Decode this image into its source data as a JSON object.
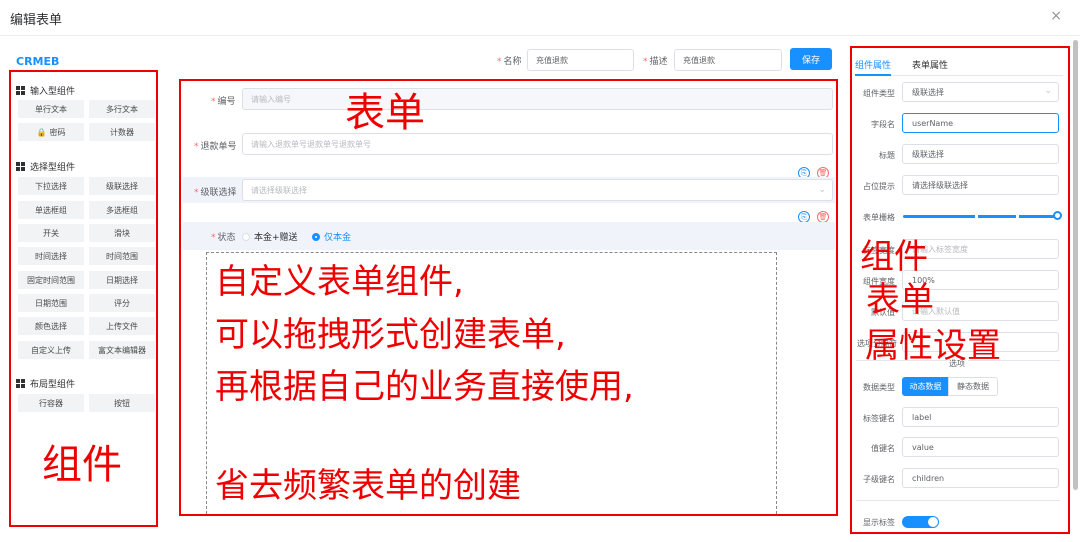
{
  "dialog": {
    "title": "编辑表单",
    "close_icon": "×"
  },
  "logo": "CRMEB",
  "palette": {
    "groups": [
      {
        "title": "输入型组件",
        "items": [
          "单行文本",
          "多行文本",
          "密码",
          "计数器"
        ]
      },
      {
        "title": "选择型组件",
        "items": [
          "下拉选择",
          "级联选择",
          "单选框组",
          "多选框组",
          "开关",
          "滑块",
          "时间选择",
          "时间范围",
          "固定时间范围",
          "日期选择",
          "日期范围",
          "评分",
          "颜色选择",
          "上传文件",
          "自定义上传",
          "富文本编辑器"
        ]
      },
      {
        "title": "布局型组件",
        "items": [
          "行容器",
          "按钮"
        ]
      }
    ],
    "annotation": "组件"
  },
  "header": {
    "name_label": "名称",
    "name_value": "充值退款",
    "desc_label": "描述",
    "desc_value": "充值退款",
    "save_label": "保存"
  },
  "form": {
    "annotation": "表单",
    "rows": {
      "number": {
        "label": "编号",
        "placeholder": "请输入编号"
      },
      "refund": {
        "label": "退款单号",
        "placeholder": "请输入退款单号退款单号退款单号"
      },
      "cascade": {
        "label": "级联选择",
        "placeholder": "请选择级联选择"
      },
      "status": {
        "label": "状态",
        "options": [
          "本金+赠送",
          "仅本金"
        ],
        "selected": "仅本金"
      }
    },
    "overlay_lines": [
      "自定义表单组件,",
      "可以拖拽形式创建表单,",
      "再根据自己的业务直接使用,",
      "省去频繁表单的创建"
    ]
  },
  "panel": {
    "tabs": [
      "组件属性",
      "表单属性"
    ],
    "active_tab": "组件属性",
    "annotation_lines": [
      "组件",
      "表单",
      "属性设置"
    ],
    "fields": {
      "type": {
        "label": "组件类型",
        "value": "级联选择"
      },
      "field": {
        "label": "字段名",
        "value": "userName"
      },
      "title": {
        "label": "标题",
        "value": "级联选择"
      },
      "placeholder": {
        "label": "占位提示",
        "value": "请选择级联选择"
      },
      "grid": {
        "label": "表单栅格"
      },
      "label_width": {
        "label": "标签宽度",
        "placeholder": "请输入标签宽度"
      },
      "comp_width": {
        "label": "组件宽度",
        "value": "100%"
      },
      "default": {
        "label": "默认值",
        "placeholder": "请输入默认值"
      },
      "sep": {
        "label": "选项分隔符"
      },
      "options_note": "选项",
      "data_type": {
        "label": "数据类型",
        "options": [
          "动态数据",
          "静态数据"
        ],
        "selected": "动态数据"
      },
      "label_key": {
        "label": "标签键名",
        "value": "label"
      },
      "value_key": {
        "label": "值键名",
        "value": "value"
      },
      "children_key": {
        "label": "子级键名",
        "value": "children"
      },
      "show_label": {
        "label": "显示标签",
        "on": true
      }
    }
  },
  "colors": {
    "accent": "#1890ff",
    "annotation": "#e00000",
    "danger": "#f56c6c"
  }
}
